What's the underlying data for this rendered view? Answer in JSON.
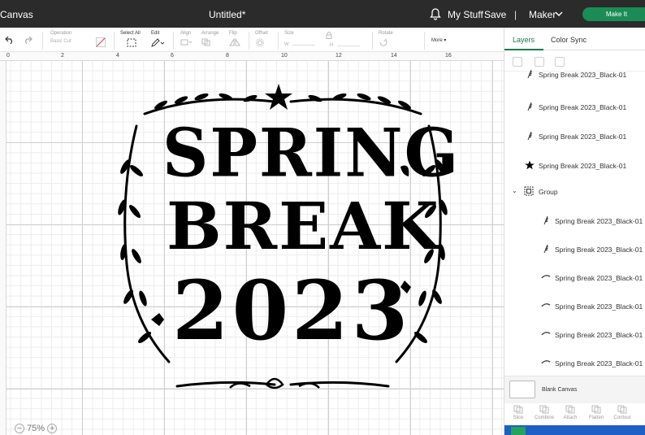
{
  "topbar": {
    "title": "Canvas",
    "document": "Untitled*",
    "my_stuff": "My Stuff",
    "save": "Save",
    "separator": "|",
    "machine": "Maker",
    "make_it": "Make It"
  },
  "toolbar": {
    "undo_icon": "undo-icon",
    "redo_icon": "redo-icon",
    "operation_label": "Operation",
    "operation_value": "Basic Cut",
    "select_all": "Select All",
    "edit": "Edit",
    "align": "Align",
    "arrange": "Arrange",
    "flip": "Flip",
    "offset": "Offset",
    "size": "Size",
    "w": "W",
    "h": "H",
    "rotate": "Rotate",
    "more": "More"
  },
  "ruler": [
    "0",
    "2",
    "4",
    "6",
    "8",
    "10",
    "12",
    "14",
    "16"
  ],
  "zoom": {
    "minus": "−",
    "level": "75%",
    "plus": "+"
  },
  "design": {
    "line1": "SPRING",
    "line2": "BREAK",
    "line3": "2023"
  },
  "panel": {
    "tabs": [
      "Layers",
      "Color Sync"
    ],
    "layers": [
      {
        "name": "Spring Break 2023_Black-01",
        "icon": "leaf-icon"
      },
      {
        "name": "Spring Break 2023_Black-01",
        "icon": "leaf-icon"
      },
      {
        "name": "Spring Break 2023_Black-01",
        "icon": "leaf-icon"
      },
      {
        "name": "Spring Break 2023_Black-01",
        "icon": "star-icon"
      }
    ],
    "group_label": "Group",
    "group_layers": [
      {
        "name": "Spring Break 2023_Black-01",
        "icon": "leaf-icon"
      },
      {
        "name": "Spring Break 2023_Black-01",
        "icon": "leaf-icon"
      },
      {
        "name": "Spring Break 2023_Black-01",
        "icon": "swirl-icon"
      },
      {
        "name": "Spring Break 2023_Black-01",
        "icon": "swirl-icon"
      },
      {
        "name": "Spring Break 2023_Black-01",
        "icon": "swirl-icon"
      },
      {
        "name": "Spring Break 2023_Black-01",
        "icon": "swirl-icon"
      }
    ],
    "blank_canvas": "Blank Canvas",
    "actions": [
      "Slice",
      "Combine",
      "Attach",
      "Flatten",
      "Contour"
    ]
  },
  "colors": {
    "accent": "#1a7a4c",
    "make_it": "#1a8c55",
    "topbar": "#2b2b2b",
    "bottom_bar": "#1d5fc7"
  }
}
